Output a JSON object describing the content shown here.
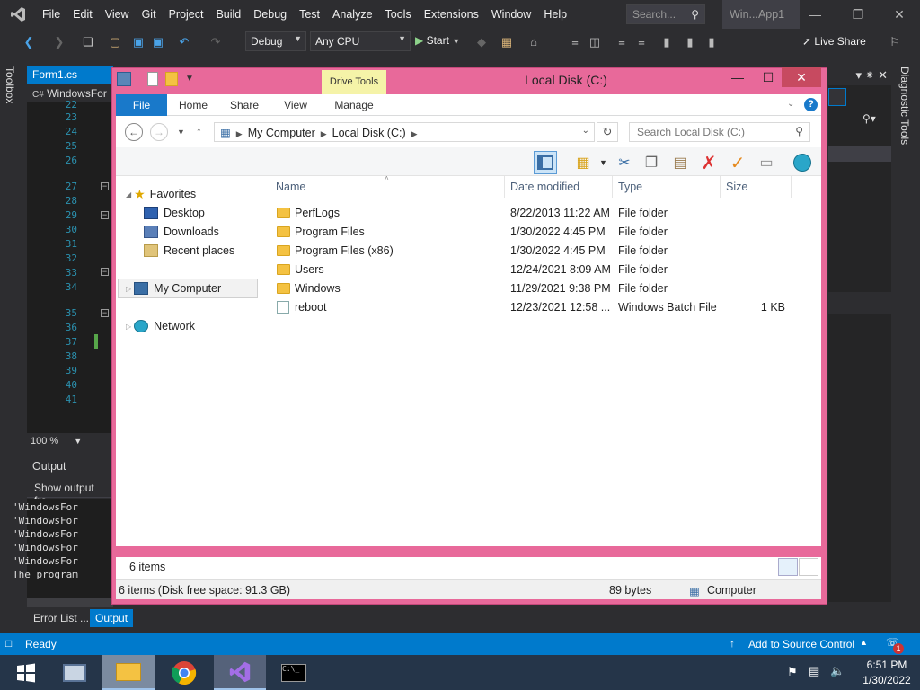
{
  "vs": {
    "menu": [
      "File",
      "Edit",
      "View",
      "Git",
      "Project",
      "Build",
      "Debug",
      "Test",
      "Analyze",
      "Tools",
      "Extensions",
      "Window",
      "Help"
    ],
    "search_placeholder": "Search...",
    "solution_name": "Win...App1",
    "config": "Debug",
    "platform": "Any CPU",
    "start_label": "Start",
    "live_share": "Live Share",
    "toolbox_label": "Toolbox",
    "diagnostic_label": "Diagnostic Tools",
    "doc_tab": "Form1.cs",
    "nav_text": "WindowsFor",
    "line_numbers": [
      "22",
      "23",
      "24",
      "25",
      "26",
      "27",
      "28",
      "29",
      "30",
      "31",
      "32",
      "33",
      "34",
      "35",
      "36",
      "37",
      "38",
      "39",
      "40",
      "41"
    ],
    "zoom": "100 %",
    "output_title": "Output",
    "output_show_from": "Show output fro",
    "output_lines": [
      "'WindowsFor",
      "'WindowsFor",
      "'WindowsFor",
      "'WindowsFor",
      "'WindowsFor",
      "The program"
    ],
    "bottom_tabs": [
      "Error List ...",
      "Output"
    ],
    "status_ready": "Ready",
    "source_control": "Add to Source Control",
    "notification_count": "1"
  },
  "explorer": {
    "title": "Local Disk (C:)",
    "drive_tools": "Drive Tools",
    "ribbon_tabs": [
      "File",
      "Home",
      "Share",
      "View",
      "Manage"
    ],
    "breadcrumb": [
      "My Computer",
      "Local Disk (C:)"
    ],
    "search_placeholder": "Search Local Disk (C:)",
    "nav": {
      "favorites": "Favorites",
      "desktop": "Desktop",
      "downloads": "Downloads",
      "recent": "Recent places",
      "computer": "My Computer",
      "network": "Network"
    },
    "columns": [
      "Name",
      "Date modified",
      "Type",
      "Size"
    ],
    "files": [
      {
        "name": "PerfLogs",
        "date": "8/22/2013 11:22 AM",
        "type": "File folder",
        "size": "",
        "kind": "folder"
      },
      {
        "name": "Program Files",
        "date": "1/30/2022 4:45 PM",
        "type": "File folder",
        "size": "",
        "kind": "folder"
      },
      {
        "name": "Program Files (x86)",
        "date": "1/30/2022 4:45 PM",
        "type": "File folder",
        "size": "",
        "kind": "folder"
      },
      {
        "name": "Users",
        "date": "12/24/2021 8:09 AM",
        "type": "File folder",
        "size": "",
        "kind": "folder"
      },
      {
        "name": "Windows",
        "date": "11/29/2021 9:38 PM",
        "type": "File folder",
        "size": "",
        "kind": "folder"
      },
      {
        "name": "reboot",
        "date": "12/23/2021 12:58 ...",
        "type": "Windows Batch File",
        "size": "1 KB",
        "kind": "batch"
      }
    ],
    "item_count": "6 items",
    "status_items": "6 items (Disk free space: 91.3 GB)",
    "status_size": "89 bytes",
    "status_location": "Computer"
  },
  "taskbar": {
    "time": "6:51 PM",
    "date": "1/30/2022"
  },
  "colors": {
    "vs_accent": "#007acc",
    "explorer_frame": "#e8699a",
    "file_tab": "#1979ca",
    "taskbar": "#253549"
  }
}
